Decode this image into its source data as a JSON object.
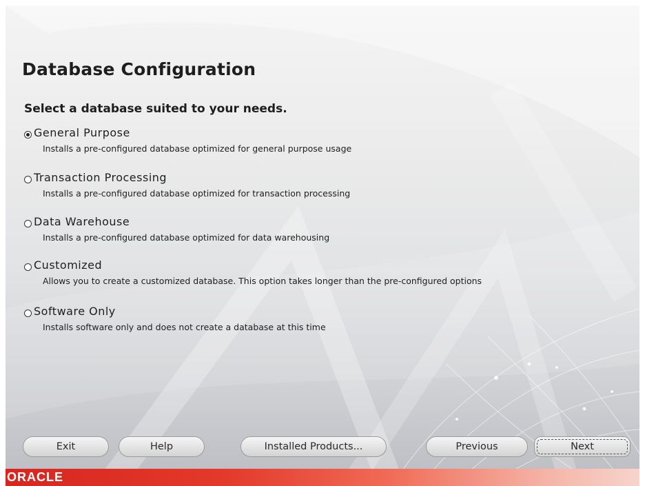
{
  "page": {
    "title": "Database Configuration",
    "subtitle": "Select a database suited to your needs."
  },
  "options": [
    {
      "label": "General Purpose",
      "description": "Installs a pre-configured database optimized for general purpose usage",
      "selected": true
    },
    {
      "label": "Transaction Processing",
      "description": "Installs a pre-configured database optimized for transaction processing",
      "selected": false
    },
    {
      "label": "Data Warehouse",
      "description": "Installs a pre-configured database optimized for data warehousing",
      "selected": false
    },
    {
      "label": "Customized",
      "description": "Allows you to create a customized database. This option takes longer than the pre-configured options",
      "selected": false
    },
    {
      "label": "Software Only",
      "description": "Installs software only and does not create a database at this time",
      "selected": false
    }
  ],
  "buttons": {
    "exit": "Exit",
    "help": "Help",
    "installed_products": "Installed Products...",
    "previous": "Previous",
    "next": "Next"
  },
  "branding": {
    "logo_text": "ORACLE",
    "brand_color": "#d7261e"
  }
}
